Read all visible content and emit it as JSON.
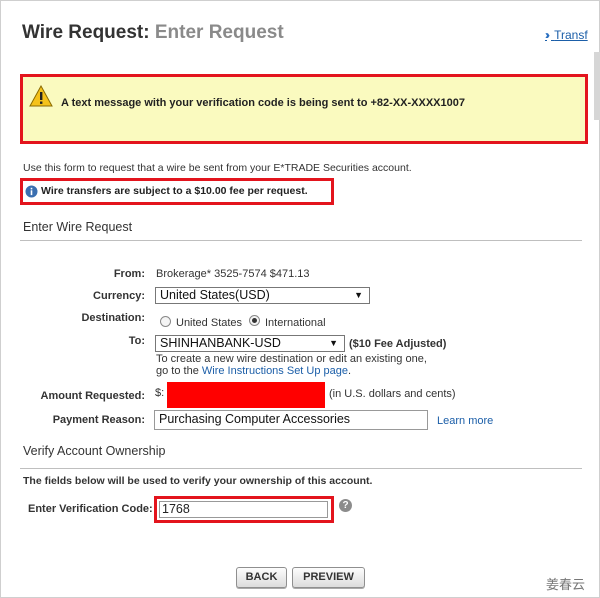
{
  "header": {
    "title_main": "Wire Request:",
    "title_sub": "Enter Request",
    "transfer_link": "Transf"
  },
  "alert": {
    "message": "A text message with your verification code is being sent to +82-XX-XXXX1007"
  },
  "intro": "Use this form to request that a wire be sent from your E*TRADE Securities account.",
  "fee_notice": "Wire transfers are subject to a $10.00 fee per request.",
  "sections": {
    "enter_wire": "Enter Wire Request",
    "verify": "Verify Account Ownership"
  },
  "form": {
    "from_label": "From:",
    "from_value": "Brokerage* 3525-7574  $471.13",
    "currency_label": "Currency:",
    "currency_value": "United States(USD)",
    "destination_label": "Destination:",
    "dest_option_us": "United States",
    "dest_option_intl": "International",
    "dest_selected": "International",
    "to_label": "To:",
    "to_value": "SHINHANBANK-USD",
    "fee_adjusted": "($10 Fee Adjusted)",
    "to_help_line1": "To create a new wire destination or edit an existing one,",
    "to_help_line2_prefix": "go to the",
    "to_help_link": "Wire Instructions Set Up page",
    "to_help_line2_suffix": ".",
    "amount_label": "Amount Requested:",
    "amount_prefix": "$:",
    "amount_hint": "(in U.S. dollars and cents)",
    "reason_label": "Payment Reason:",
    "reason_value": "Purchasing Computer Accessories",
    "learn_more": "Learn more"
  },
  "verify": {
    "note": "The fields below will be used to verify your ownership of this account.",
    "code_label": "Enter Verification Code:",
    "code_value": "1768",
    "help_glyph": "?"
  },
  "buttons": {
    "back": "BACK",
    "preview": "PREVIEW"
  },
  "watermark": "姜春云",
  "colors": {
    "highlight_red": "#e3141d",
    "alert_bg": "#fafabf",
    "link_blue": "#1b5ea8",
    "redaction": "#ff0000"
  }
}
